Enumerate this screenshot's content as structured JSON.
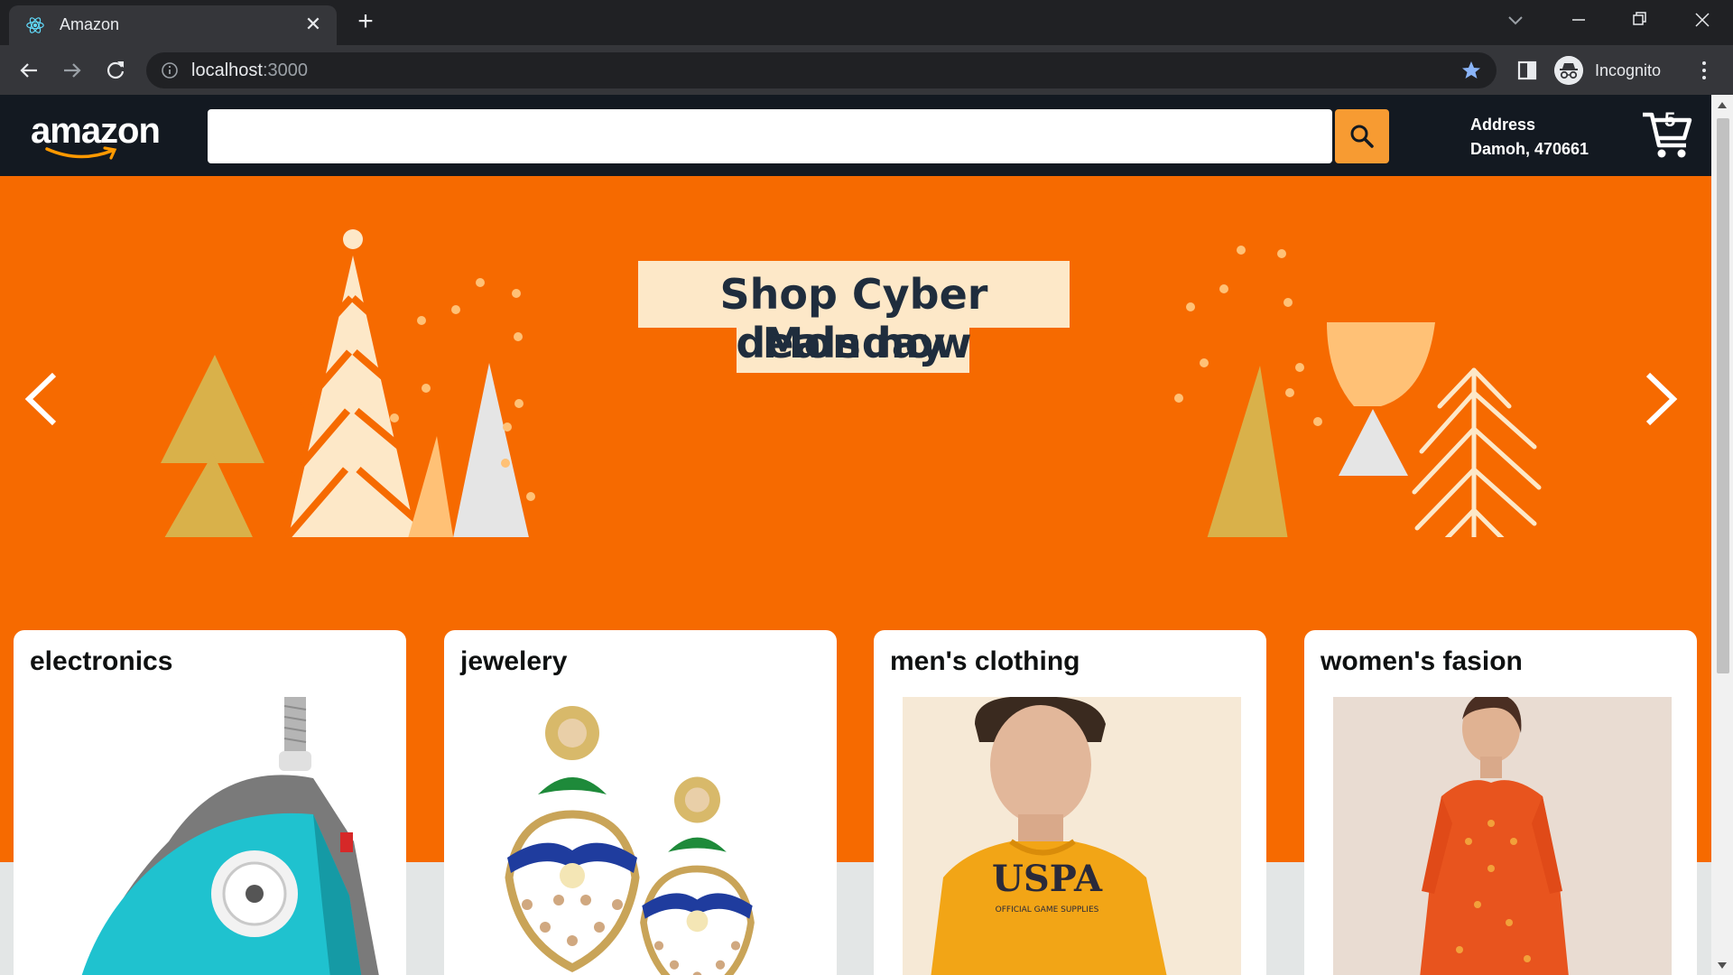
{
  "browser": {
    "tab_title": "Amazon",
    "url_host": "localhost",
    "url_port": ":3000",
    "profile_label": "Incognito"
  },
  "header": {
    "logo_text": "amazon",
    "search_placeholder": "",
    "address_label": "Address",
    "address_value": "Damoh, 470661",
    "cart_count": "5"
  },
  "hero": {
    "line1": "Shop Cyber Monday",
    "line2": "deals now"
  },
  "categories": [
    {
      "title": "electronics"
    },
    {
      "title": "jewelery"
    },
    {
      "title": "men's clothing"
    },
    {
      "title": "women's fasion"
    }
  ],
  "colors": {
    "header_bg": "#131921",
    "hero_bg": "#f66a00",
    "search_button": "#f79b32",
    "page_bg": "#e3e6e6"
  }
}
